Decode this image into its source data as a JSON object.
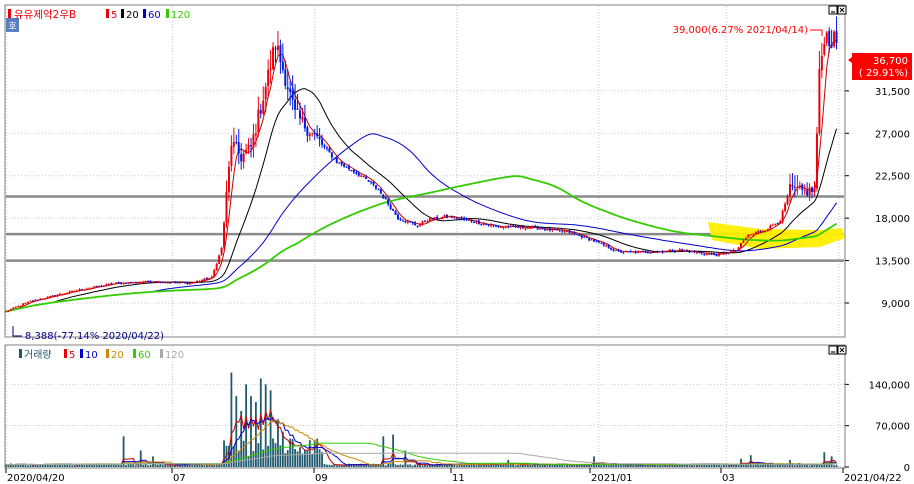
{
  "colors": {
    "up": "#e8000b",
    "down": "#0018e0",
    "ma5": "#cc0000",
    "ma20": "#000000",
    "ma60": "#0000cc",
    "ma120": "#33cc00",
    "vol": "#1f5a6e",
    "vol_ma20": "#cc8800",
    "vol_ma120": "#a8a8a8",
    "grid": "#c8c8c8",
    "hline": "#8a8a8a",
    "highlight": "#ffee00",
    "price_box": "#ff0000"
  },
  "chart_data": [
    {
      "type": "candlestick",
      "legend": {
        "icon": "호",
        "name": "유유제약2우B",
        "items": [
          {
            "label": "5",
            "color": "#e8000b"
          },
          {
            "label": "20",
            "color": "#000000"
          },
          {
            "label": "60",
            "color": "#0000cc"
          },
          {
            "label": "120",
            "color": "#33cc00"
          }
        ]
      },
      "x_ticks": [
        "2020/04/20",
        "07",
        "09",
        "11",
        "2021/01",
        "03",
        "2021/04/22"
      ],
      "y_ticks": [
        9000,
        13500,
        18000,
        22500,
        27000,
        31500
      ],
      "y_tick_labels": [
        "9,000",
        "13,500",
        "18,000",
        "22,500",
        "27,000",
        "31,500"
      ],
      "ylim": [
        5500,
        40500
      ],
      "current_price": {
        "value": 36700,
        "label": "36,700",
        "change": "( 29.91%)"
      },
      "annotations": [
        {
          "label": "39,000(6.27% 2021/04/14)",
          "value": 39000,
          "kind": "max"
        },
        {
          "label": "8,388(-77.14% 2020/04/22)",
          "value": 8388,
          "kind": "min"
        }
      ],
      "horizontal_lines": [
        20300,
        16300,
        13500
      ],
      "keyframes": [
        [
          0,
          8100
        ],
        [
          10,
          9200
        ],
        [
          30,
          10400
        ],
        [
          45,
          11100
        ],
        [
          60,
          11300
        ],
        [
          75,
          11100
        ],
        [
          84,
          11700
        ],
        [
          88,
          14800
        ],
        [
          92,
          26000
        ],
        [
          96,
          24500
        ],
        [
          100,
          25500
        ],
        [
          106,
          32000
        ],
        [
          110,
          36500
        ],
        [
          114,
          33000
        ],
        [
          118,
          29000
        ],
        [
          125,
          27000
        ],
        [
          135,
          24000
        ],
        [
          145,
          22500
        ],
        [
          152,
          21000
        ],
        [
          160,
          18000
        ],
        [
          168,
          17200
        ],
        [
          172,
          17800
        ],
        [
          180,
          18200
        ],
        [
          190,
          17700
        ],
        [
          200,
          17100
        ],
        [
          215,
          17000
        ],
        [
          230,
          16500
        ],
        [
          240,
          15600
        ],
        [
          250,
          14400
        ],
        [
          260,
          14400
        ],
        [
          275,
          14600
        ],
        [
          290,
          14100
        ],
        [
          298,
          14600
        ],
        [
          303,
          16200
        ],
        [
          310,
          16800
        ],
        [
          316,
          17800
        ],
        [
          320,
          21000
        ],
        [
          326,
          20800
        ],
        [
          330,
          21000
        ],
        [
          332,
          33000
        ],
        [
          334,
          37500
        ],
        [
          338,
          36700
        ]
      ],
      "ma_series": [
        {
          "name": "5",
          "period": 5
        },
        {
          "name": "20",
          "period": 20
        },
        {
          "name": "60",
          "period": 60
        },
        {
          "name": "120",
          "period": 120
        }
      ]
    },
    {
      "type": "bar",
      "legend": {
        "name": "거래량",
        "items": [
          {
            "label": "5",
            "color": "#e8000b"
          },
          {
            "label": "10",
            "color": "#0000cc"
          },
          {
            "label": "20",
            "color": "#cc8800"
          },
          {
            "label": "60",
            "color": "#33cc00"
          },
          {
            "label": "120",
            "color": "#a8a8a8"
          }
        ]
      },
      "y_ticks": [
        0,
        70000,
        140000
      ],
      "y_tick_labels": [
        "0",
        "70,000",
        "140,000"
      ],
      "ylim": [
        0,
        205000
      ],
      "bursts": [
        [
          48,
          52000
        ],
        [
          55,
          28000
        ],
        [
          60,
          18000
        ],
        [
          89,
          45000
        ],
        [
          92,
          160000
        ],
        [
          94,
          120000
        ],
        [
          96,
          95000
        ],
        [
          98,
          140000
        ],
        [
          100,
          120000
        ],
        [
          102,
          110000
        ],
        [
          104,
          150000
        ],
        [
          106,
          140000
        ],
        [
          108,
          130000
        ],
        [
          111,
          80000
        ],
        [
          113,
          60000
        ],
        [
          116,
          45000
        ],
        [
          118,
          30000
        ],
        [
          120,
          25000
        ],
        [
          154,
          52000
        ],
        [
          158,
          55000
        ],
        [
          163,
          28000
        ],
        [
          205,
          12000
        ],
        [
          240,
          18000
        ],
        [
          300,
          14000
        ],
        [
          304,
          20000
        ],
        [
          320,
          12000
        ],
        [
          334,
          25000
        ],
        [
          337,
          18000
        ]
      ]
    }
  ]
}
